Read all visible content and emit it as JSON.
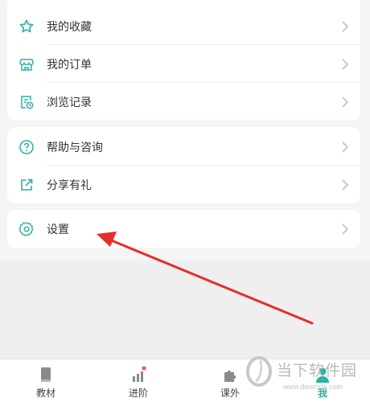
{
  "menu_group_1": [
    {
      "label": "我的收藏",
      "icon": "star-icon"
    },
    {
      "label": "我的订单",
      "icon": "shop-icon"
    },
    {
      "label": "浏览记录",
      "icon": "history-icon"
    }
  ],
  "menu_group_2": [
    {
      "label": "帮助与咨询",
      "icon": "help-icon"
    },
    {
      "label": "分享有礼",
      "icon": "share-icon"
    }
  ],
  "menu_group_3": [
    {
      "label": "设置",
      "icon": "settings-icon"
    }
  ],
  "tabbar": [
    {
      "label": "教材",
      "icon": "book-icon",
      "active": false
    },
    {
      "label": "进阶",
      "icon": "chart-icon",
      "active": false
    },
    {
      "label": "课外",
      "icon": "puzzle-icon",
      "active": false
    },
    {
      "label": "我",
      "icon": "person-icon",
      "active": true
    }
  ],
  "watermark": {
    "text": "当下软件园",
    "url": "www.downxia.com"
  },
  "colors": {
    "accent": "#2bb3a3",
    "arrow": "#e82b2b",
    "badge": "#ff4d4f"
  }
}
